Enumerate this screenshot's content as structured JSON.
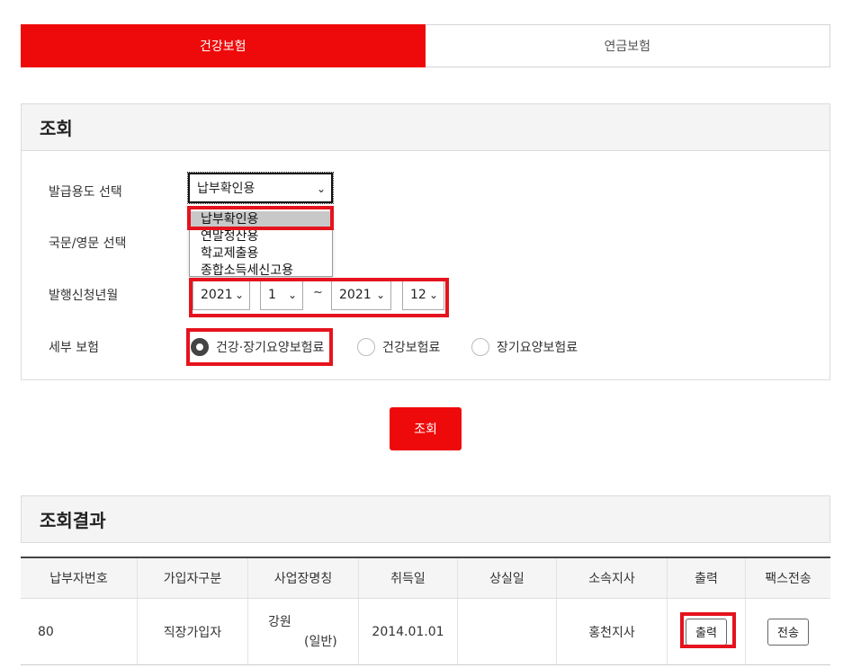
{
  "tabs": [
    {
      "label": "건강보험",
      "active": true
    },
    {
      "label": "연금보험",
      "active": false
    }
  ],
  "query": {
    "title": "조회",
    "purpose": {
      "label": "발급용도 선택",
      "selected": "납부확인용",
      "options": [
        "납부확인용",
        "연말정산용",
        "학교제출용",
        "종합소득세신고용"
      ]
    },
    "language": {
      "label": "국문/영문 선택"
    },
    "period": {
      "label": "발행신청년월",
      "from_year": "2021",
      "from_month": "1",
      "separator": "~",
      "to_year": "2021",
      "to_month": "12"
    },
    "detail": {
      "label": "세부 보험",
      "options": [
        {
          "label": "건강·장기요양보험료",
          "checked": true
        },
        {
          "label": "건강보험료",
          "checked": false
        },
        {
          "label": "장기요양보험료",
          "checked": false
        }
      ]
    },
    "search_button": "조회"
  },
  "results": {
    "title": "조회결과",
    "columns": [
      "납부자번호",
      "가입자구분",
      "사업장명칭",
      "취득일",
      "상실일",
      "소속지사",
      "출력",
      "팩스전송"
    ],
    "rows": [
      {
        "payer_no": "80",
        "subscriber_type": "직장가입자",
        "workplace_line1": "강원",
        "workplace_line2": "(일반)",
        "acquired": "2014.01.01",
        "lost": "",
        "branch": "홍천지사",
        "print_button": "출력",
        "fax_button": "전송"
      }
    ]
  },
  "colors": {
    "accent": "#ee0a0a",
    "highlight": "#e5131d"
  }
}
